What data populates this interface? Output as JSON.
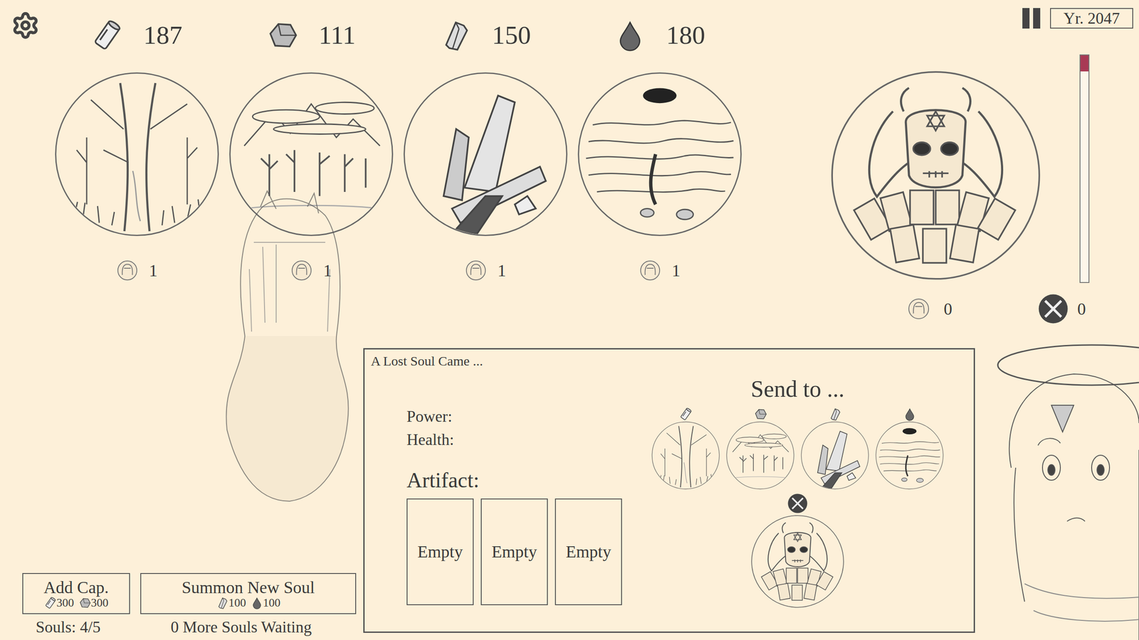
{
  "resources": [
    {
      "kind": "wood",
      "amount": "187",
      "souls": "1"
    },
    {
      "kind": "stone",
      "amount": "111",
      "souls": "1"
    },
    {
      "kind": "crystal",
      "amount": "150",
      "souls": "1"
    },
    {
      "kind": "drop",
      "amount": "180",
      "souls": "1"
    }
  ],
  "demon": {
    "souls": "0",
    "warriors": "0"
  },
  "threat_bar": {
    "level": 0.07
  },
  "year": "Yr. 2047",
  "dialog": {
    "title": "A Lost Soul Came ...",
    "stats": [
      {
        "label": "Power:"
      },
      {
        "label": "Health:"
      }
    ],
    "artifact_label": "Artifact:",
    "artifact_slots": [
      "Empty",
      "Empty",
      "Empty"
    ],
    "send_to_label": "Send to ...",
    "destinations": [
      {
        "kind": "wood"
      },
      {
        "kind": "stone"
      },
      {
        "kind": "crystal"
      },
      {
        "kind": "drop"
      }
    ],
    "demon_destination": {
      "kind": "demon"
    }
  },
  "buttons": [
    {
      "label": "Add Cap.",
      "costs": [
        {
          "kind": "wood",
          "amount": "300"
        },
        {
          "kind": "stone",
          "amount": "300"
        }
      ]
    },
    {
      "label": "Summon New Soul",
      "costs": [
        {
          "kind": "crystal",
          "amount": "100"
        },
        {
          "kind": "drop",
          "amount": "100"
        }
      ]
    }
  ],
  "souls_label": "Souls: 4/5",
  "waiting_label": "0 More Souls Waiting"
}
